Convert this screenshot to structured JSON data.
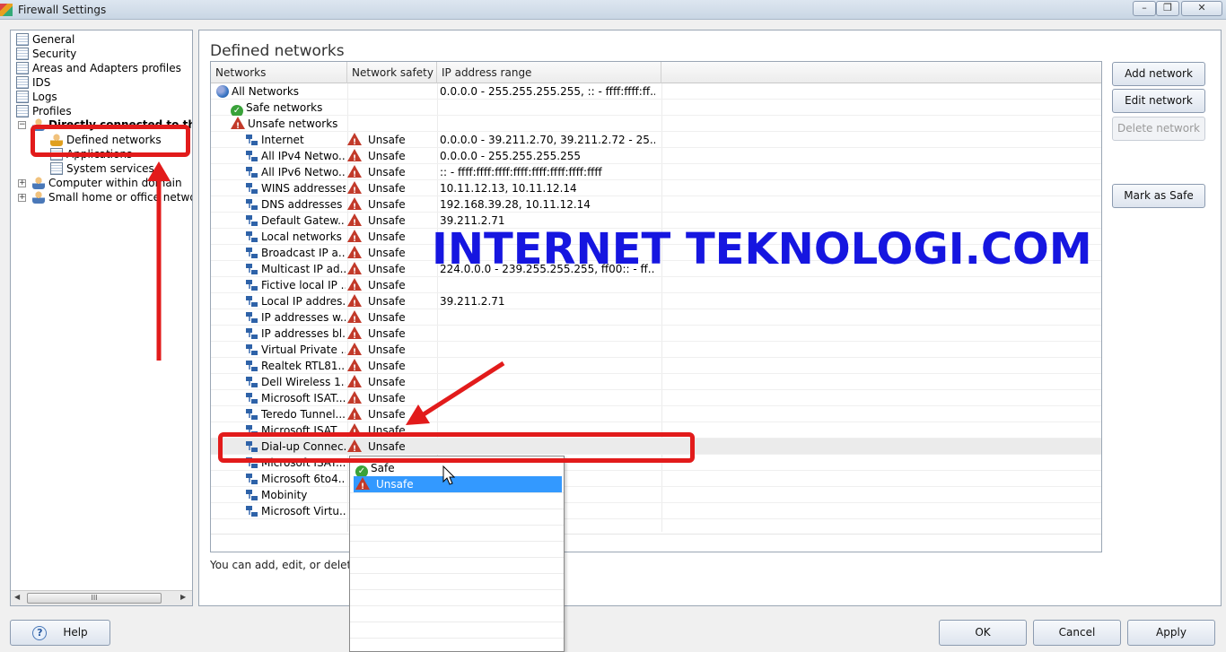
{
  "window": {
    "title": "Firewall Settings",
    "minimize": "–",
    "restore": "❐",
    "close": "✕"
  },
  "tree": {
    "items": [
      {
        "label": "General",
        "icon": "page-icon"
      },
      {
        "label": "Security",
        "icon": "page-icon"
      },
      {
        "label": "Areas and Adapters profiles",
        "icon": "page-icon"
      },
      {
        "label": "IDS",
        "icon": "page-icon"
      },
      {
        "label": "Logs",
        "icon": "page-icon"
      },
      {
        "label": "Profiles",
        "icon": "page-icon"
      },
      {
        "label": "Directly connected to the",
        "icon": "user-icon"
      },
      {
        "label": "Defined networks",
        "icon": "user-network-icon"
      },
      {
        "label": "Applications",
        "icon": "page-icon"
      },
      {
        "label": "System services",
        "icon": "page-icon"
      },
      {
        "label": "Computer within domain",
        "icon": "user-icon"
      },
      {
        "label": "Small home or office network",
        "icon": "user-icon"
      }
    ],
    "scroll_grip": "III"
  },
  "main": {
    "title": "Defined networks",
    "columns": [
      "Networks",
      "Network safety",
      "IP address range"
    ],
    "rows": [
      {
        "name": "All Networks",
        "safety": "",
        "ip": "0.0.0.0 - 255.255.255.255, :: - ffff:ffff:ff...",
        "icon": "globe-icon"
      },
      {
        "name": "Safe networks",
        "safety": "",
        "ip": "",
        "icon": "check-icon"
      },
      {
        "name": "Unsafe networks",
        "safety": "",
        "ip": "",
        "icon": "warning-icon"
      },
      {
        "name": "Internet",
        "safety": "Unsafe",
        "ip": "0.0.0.0 - 39.211.2.70, 39.211.2.72 - 25...",
        "icon": "network-icon"
      },
      {
        "name": "All IPv4 Netwo...",
        "safety": "Unsafe",
        "ip": "0.0.0.0 - 255.255.255.255",
        "icon": "network-icon"
      },
      {
        "name": "All IPv6 Netwo...",
        "safety": "Unsafe",
        "ip": ":: - ffff:ffff:ffff:ffff:ffff:ffff:ffff:ffff",
        "icon": "network-icon"
      },
      {
        "name": "WINS addresses",
        "safety": "Unsafe",
        "ip": "10.11.12.13, 10.11.12.14",
        "icon": "network-icon"
      },
      {
        "name": "DNS addresses",
        "safety": "Unsafe",
        "ip": "192.168.39.28, 10.11.12.14",
        "icon": "network-icon"
      },
      {
        "name": "Default Gatew...",
        "safety": "Unsafe",
        "ip": "39.211.2.71",
        "icon": "network-icon"
      },
      {
        "name": "Local networks",
        "safety": "Unsafe",
        "ip": "",
        "icon": "network-icon"
      },
      {
        "name": "Broadcast IP a...",
        "safety": "Unsafe",
        "ip": "",
        "icon": "network-icon"
      },
      {
        "name": "Multicast IP ad...",
        "safety": "Unsafe",
        "ip": "224.0.0.0 - 239.255.255.255, ff00:: - ff...",
        "icon": "network-icon"
      },
      {
        "name": "Fictive local IP ...",
        "safety": "Unsafe",
        "ip": "",
        "icon": "network-icon"
      },
      {
        "name": "Local IP addres...",
        "safety": "Unsafe",
        "ip": "39.211.2.71",
        "icon": "network-icon"
      },
      {
        "name": "IP addresses w...",
        "safety": "Unsafe",
        "ip": "",
        "icon": "network-icon"
      },
      {
        "name": "IP addresses bl...",
        "safety": "Unsafe",
        "ip": "",
        "icon": "network-icon"
      },
      {
        "name": "Virtual Private ...",
        "safety": "Unsafe",
        "ip": "",
        "icon": "network-icon"
      },
      {
        "name": "Realtek RTL81...",
        "safety": "Unsafe",
        "ip": "",
        "icon": "network-icon"
      },
      {
        "name": "Dell Wireless 1...",
        "safety": "Unsafe",
        "ip": "",
        "icon": "network-icon"
      },
      {
        "name": "Microsoft ISAT...",
        "safety": "Unsafe",
        "ip": "",
        "icon": "network-icon"
      },
      {
        "name": "Teredo Tunnel...",
        "safety": "Unsafe",
        "ip": "",
        "icon": "network-icon"
      },
      {
        "name": "Microsoft ISAT...",
        "safety": "Unsafe",
        "ip": "",
        "icon": "network-icon"
      },
      {
        "name": "Dial-up Connec...",
        "safety": "Unsafe",
        "ip": "",
        "icon": "network-icon",
        "selected": true
      },
      {
        "name": "Microsoft ISAT...",
        "safety": "",
        "ip": "",
        "icon": "network-icon"
      },
      {
        "name": "Microsoft 6to4...",
        "safety": "",
        "ip": "",
        "icon": "network-icon"
      },
      {
        "name": "Mobinity",
        "safety": "",
        "ip": "",
        "icon": "network-icon"
      },
      {
        "name": "Microsoft Virtu...",
        "safety": "",
        "ip": "",
        "icon": "network-icon"
      }
    ],
    "hint": "You can add, edit, or delete"
  },
  "side_buttons": {
    "add": "Add network",
    "edit": "Edit network",
    "delete": "Delete network",
    "mark_safe": "Mark as Safe"
  },
  "dropdown": {
    "options": [
      {
        "label": "Safe",
        "icon": "check-icon"
      },
      {
        "label": "Unsafe",
        "icon": "warning-icon",
        "selected": true
      }
    ]
  },
  "bottom": {
    "help": "Help",
    "ok": "OK",
    "cancel": "Cancel",
    "apply": "Apply"
  },
  "overlay": {
    "watermark": "INTERNET TEKNOLOGI.COM"
  },
  "colors": {
    "highlight": "#e21b1b",
    "watermark": "#1616e0",
    "selection": "#3399ff"
  }
}
